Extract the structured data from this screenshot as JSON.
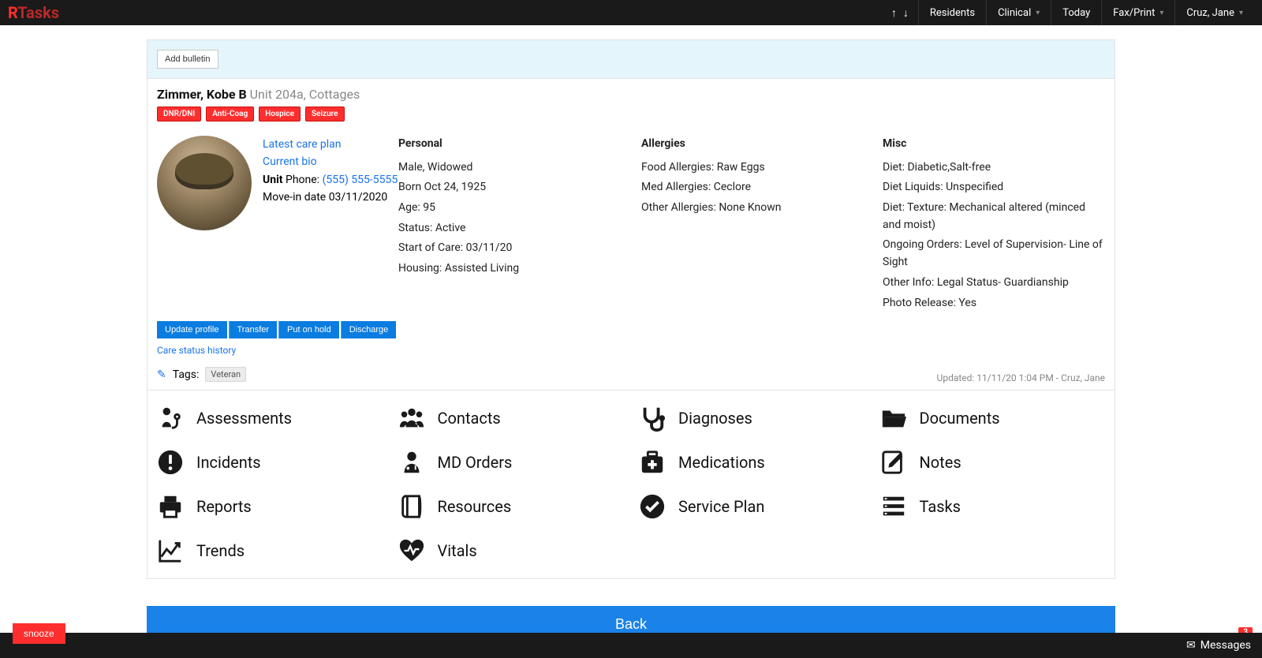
{
  "brand": {
    "prefix": "R",
    "rest": "Tasks"
  },
  "nav": {
    "residents": "Residents",
    "clinical": "Clinical",
    "today": "Today",
    "faxprint": "Fax/Print",
    "user": "Cruz, Jane"
  },
  "bulletin": {
    "add_button": "Add bulletin"
  },
  "resident": {
    "name": "Zimmer, Kobe B",
    "location": "Unit 204a, Cottages",
    "badges": [
      "DNR/DNI",
      "Anti-Coag",
      "Hospice",
      "Seizure"
    ]
  },
  "left_links": {
    "latest_care_plan": "Latest care plan",
    "current_bio": "Current bio",
    "unit_label": "Unit",
    "phone_label": " Phone: ",
    "phone": "(555) 555-5555",
    "movein_label": "Move-in date ",
    "movein_date": "03/11/2020"
  },
  "personal": {
    "header": "Personal",
    "lines": [
      "Male, Widowed",
      "Born Oct 24, 1925",
      "Age: 95",
      "Status: Active",
      "Start of Care: 03/11/20",
      "Housing: Assisted Living"
    ]
  },
  "allergies": {
    "header": "Allergies",
    "lines": [
      "Food Allergies: Raw Eggs",
      "Med Allergies: Ceclore",
      "Other Allergies: None Known"
    ]
  },
  "misc": {
    "header": "Misc",
    "lines": [
      "Diet: Diabetic,Salt-free",
      "Diet Liquids: Unspecified",
      "Diet: Texture: Mechanical altered (minced and moist)",
      "Ongoing Orders: Level of Supervision- Line of Sight",
      "Other Info: Legal Status- Guardianship",
      "Photo Release: Yes"
    ]
  },
  "actions": {
    "update": "Update profile",
    "transfer": "Transfer",
    "hold": "Put on hold",
    "discharge": "Discharge"
  },
  "care_status_history": "Care status history",
  "tags": {
    "label": "Tags:",
    "items": [
      "Veteran"
    ]
  },
  "updated": "Updated: 11/11/20 1:04 PM - Cruz, Jane",
  "modules": {
    "assessments": "Assessments",
    "contacts": "Contacts",
    "diagnoses": "Diagnoses",
    "documents": "Documents",
    "incidents": "Incidents",
    "md_orders": "MD Orders",
    "medications": "Medications",
    "notes": "Notes",
    "reports": "Reports",
    "resources": "Resources",
    "service_plan": "Service Plan",
    "tasks": "Tasks",
    "trends": "Trends",
    "vitals": "Vitals"
  },
  "back": "Back",
  "snooze": "snooze",
  "messages": {
    "label": "Messages",
    "count": "3"
  }
}
